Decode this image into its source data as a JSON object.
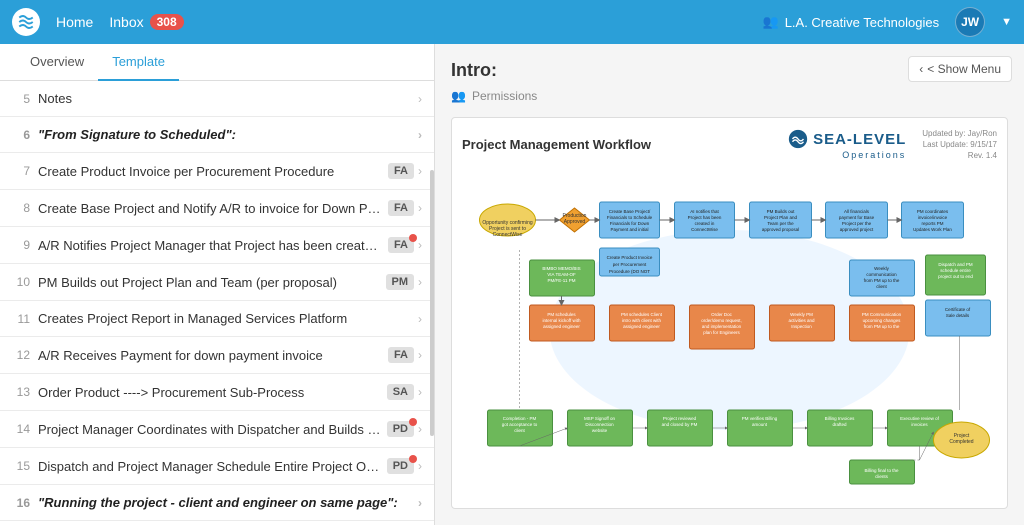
{
  "nav": {
    "logo_text": "W",
    "home_label": "Home",
    "inbox_label": "Inbox",
    "inbox_count": "308",
    "org_label": "L.A. Creative Technologies",
    "avatar_label": "JW",
    "org_icon": "👥"
  },
  "tabs": {
    "overview_label": "Overview",
    "template_label": "Template"
  },
  "list_items": [
    {
      "num": "5",
      "text": "Notes",
      "badge": null,
      "bold": false,
      "has_dot": false
    },
    {
      "num": "6",
      "text": "\"From Signature to Scheduled\":",
      "badge": null,
      "bold": true,
      "has_dot": false
    },
    {
      "num": "7",
      "text": "Create Product Invoice per Procurement Procedure",
      "badge": "FA",
      "bold": false,
      "has_dot": false
    },
    {
      "num": "8",
      "text": "Create Base Project and Notify A/R to invoice for Down Paymer",
      "badge": "FA",
      "bold": false,
      "has_dot": false
    },
    {
      "num": "9",
      "text": "A/R Notifies Project Manager that Project has been created in C",
      "badge": "FA",
      "bold": false,
      "has_dot": true
    },
    {
      "num": "10",
      "text": "PM Builds out Project Plan and Team (per proposal)",
      "badge": "PM",
      "bold": false,
      "has_dot": false
    },
    {
      "num": "11",
      "text": "Creates Project Report in Managed Services Platform",
      "badge": null,
      "bold": false,
      "has_dot": false
    },
    {
      "num": "12",
      "text": "A/R Receives Payment for down payment invoice",
      "badge": "FA",
      "bold": false,
      "has_dot": false
    },
    {
      "num": "13",
      "text": "Order Product ----> Procurement Sub-Process",
      "badge": "SA",
      "bold": false,
      "has_dot": false
    },
    {
      "num": "14",
      "text": "Project Manager Coordinates with Dispatcher and Builds Work",
      "badge": "PD",
      "bold": false,
      "has_dot": true
    },
    {
      "num": "15",
      "text": "Dispatch and Project Manager Schedule Entire Project Out to E",
      "badge": "PD",
      "bold": false,
      "has_dot": true
    },
    {
      "num": "16",
      "text": "\"Running the project - client and engineer on same page\":",
      "badge": null,
      "bold": true,
      "has_dot": false
    }
  ],
  "right_panel": {
    "show_menu_label": "< Show Menu",
    "intro_title": "Intro:",
    "permissions_label": "Permissions",
    "diagram_title": "Project Management Workflow",
    "sea_level_name": "SEA-LEVEL",
    "sea_level_sub": "Operations",
    "diagram_meta_line1": "Updated by: Jay/Ron",
    "diagram_meta_line2": "Last Update: 9/15/17",
    "diagram_meta_line3": "Rev. 1.4"
  }
}
